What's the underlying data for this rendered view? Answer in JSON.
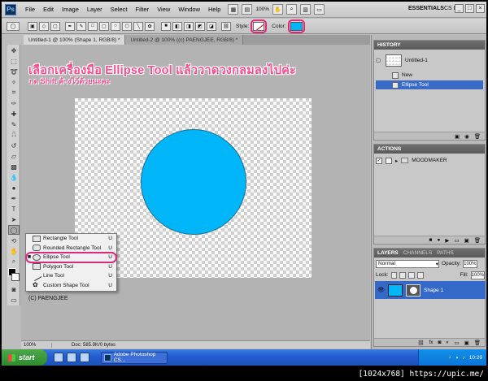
{
  "menubar": {
    "logo": "Ps",
    "items": [
      "File",
      "Edit",
      "Image",
      "Layer",
      "Select",
      "Filter",
      "View",
      "Window",
      "Help"
    ],
    "zoom_value": "100%",
    "workspace": "ESSENTIALS",
    "cs_live": "CS Live"
  },
  "options": {
    "style_label": "Style:",
    "color_label": "Color:",
    "fill_color": "#00b6f8"
  },
  "tabs": [
    {
      "label": "Untitled-1 @ 100% (Shape 1, RGB/8) *"
    },
    {
      "label": "Untitled-2 @ 100% ((c) PAENGJEE, RGB/8) *"
    }
  ],
  "canvas": {
    "headline": "เลือกเครื่องมือ Ellipse Tool แล้ววาดวงกลมลงไปค่ะ",
    "subline": "กด Shift ค้างไว้ด้วยนะคะ",
    "copyright": "(C) PAENGJEE",
    "shape_color": "#00b6f8"
  },
  "flyout": {
    "items": [
      {
        "label": "Rectangle Tool",
        "key": "U",
        "selected": false
      },
      {
        "label": "Rounded Rectangle Tool",
        "key": "U",
        "selected": false
      },
      {
        "label": "Ellipse Tool",
        "key": "U",
        "selected": true
      },
      {
        "label": "Polygon Tool",
        "key": "U",
        "selected": false
      },
      {
        "label": "Line Tool",
        "key": "U",
        "selected": false
      },
      {
        "label": "Custom Shape Tool",
        "key": "U",
        "selected": false
      }
    ]
  },
  "status": {
    "zoom": "100%",
    "doc": "Doc: 585.9K/0 bytes"
  },
  "history": {
    "title": "HISTORY",
    "snapshot": "Untitled-1",
    "rows": [
      {
        "label": "New",
        "selected": false
      },
      {
        "label": "Ellipse Tool",
        "selected": true
      }
    ]
  },
  "actions": {
    "title": "ACTIONS",
    "set": "MOODMAKER"
  },
  "layers": {
    "tabs": [
      "LAYERS",
      "CHANNELS",
      "PATHS"
    ],
    "blend": "Normal",
    "opacity_label": "Opacity:",
    "opacity": "100%",
    "lock_label": "Lock:",
    "fill_label": "Fill:",
    "fill": "100%",
    "layer_name": "Shape 1"
  },
  "taskbar": {
    "start": "start",
    "task": "Adobe Photoshop CS...",
    "lang": "EN",
    "clock": "10:29"
  },
  "watermark": "[1024x768] https://upic.me/"
}
